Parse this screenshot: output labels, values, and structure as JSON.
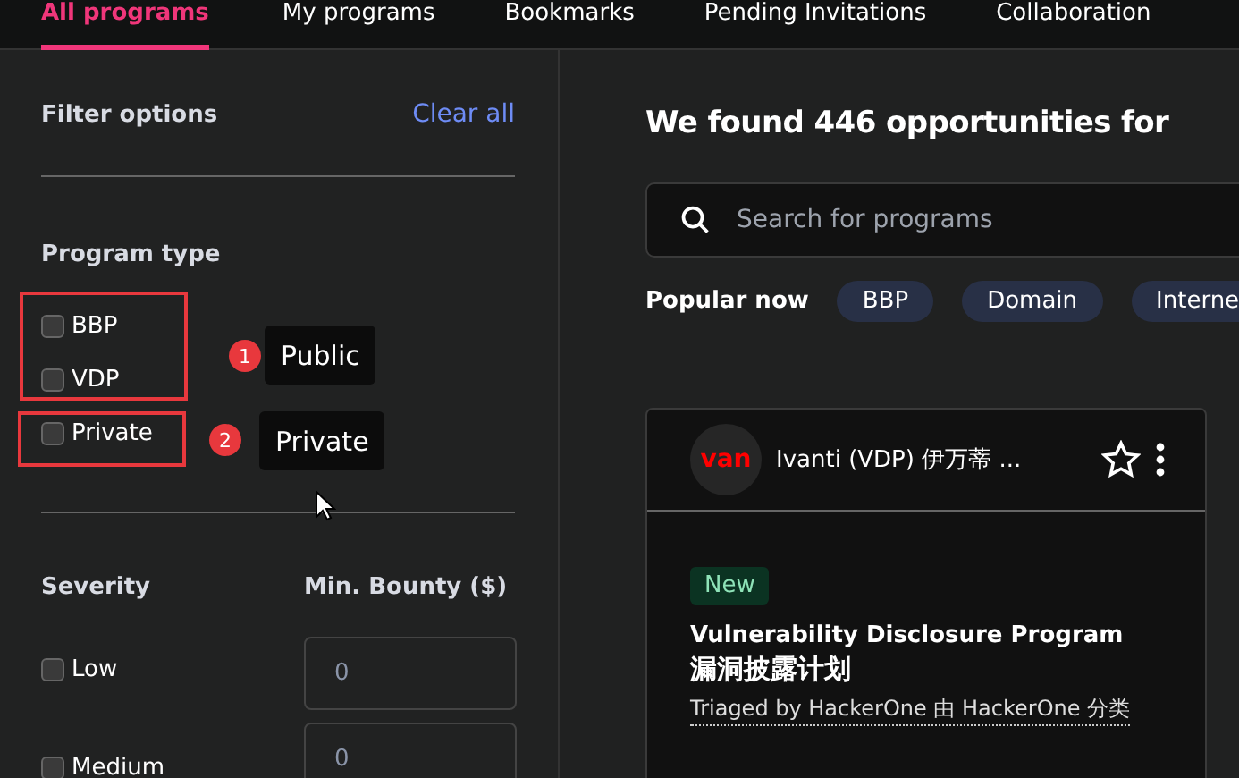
{
  "tabs": [
    {
      "label": "All programs",
      "selected": true
    },
    {
      "label": "My programs",
      "selected": false
    },
    {
      "label": "Bookmarks",
      "selected": false
    },
    {
      "label": "Pending Invitations",
      "selected": false
    },
    {
      "label": "Collaboration",
      "selected": false
    }
  ],
  "filters": {
    "title": "Filter options",
    "clear_all": "Clear all",
    "program_type": {
      "heading": "Program type",
      "options": [
        {
          "label": "BBP",
          "checked": false
        },
        {
          "label": "VDP",
          "checked": false
        },
        {
          "label": "Private",
          "checked": false
        }
      ]
    },
    "severity": {
      "heading": "Severity",
      "options": [
        {
          "label": "Low",
          "checked": false
        },
        {
          "label": "Medium",
          "checked": false
        }
      ]
    },
    "min_bounty": {
      "heading": "Min. Bounty ($)",
      "fields": [
        {
          "placeholder": "0"
        },
        {
          "placeholder": "0"
        }
      ]
    }
  },
  "annotations": [
    {
      "number": "1",
      "note": "Public"
    },
    {
      "number": "2",
      "note": "Private"
    }
  ],
  "main": {
    "heading": "We found 446 opportunities for",
    "search": {
      "placeholder": "Search for programs"
    },
    "popular_label": "Popular now",
    "chips": [
      "BBP",
      "Domain",
      "Interne"
    ],
    "card": {
      "logo": "van",
      "name": "Ivanti (VDP) 伊万蒂 ...",
      "bookmarked": false,
      "badge": "New",
      "title": "Vulnerability Disclosure Program",
      "subtitle": "漏洞披露计划",
      "triage": "Triaged by HackerOne 由 HackerOne 分类"
    }
  }
}
